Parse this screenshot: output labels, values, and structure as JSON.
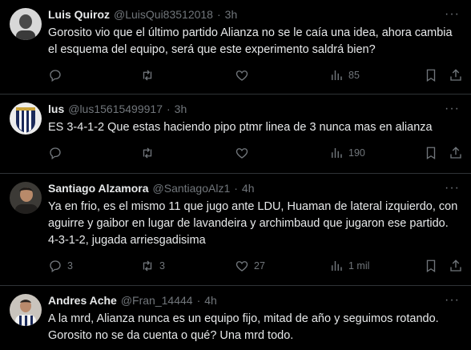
{
  "tweets": [
    {
      "name": "Luis Quiroz",
      "handle": "@LuisQui83512018",
      "dot": "·",
      "time": "3h",
      "text": "Gorosito vio que el último partido Alianza no se le caía una idea, ahora cambia el esquema del equipo,  será que este experimento saldrá bien?",
      "replies": "",
      "retweets": "",
      "likes": "",
      "views": "85"
    },
    {
      "name": "lus",
      "handle": "@lus15615499917",
      "dot": "·",
      "time": "3h",
      "text": "ES 3-4-1-2 Que estas haciendo pipo ptmr linea de 3 nunca mas en alianza",
      "replies": "",
      "retweets": "",
      "likes": "",
      "views": "190"
    },
    {
      "name": "Santiago Alzamora",
      "handle": "@SantiagoAlz1",
      "dot": "·",
      "time": "4h",
      "text": "Ya en frio, es el mismo 11 que jugo ante LDU, Huaman de lateral izquierdo, con aguirre y gaibor en lugar de lavandeira y archimbaud que jugaron ese partido. 4-3-1-2, jugada arriesgadisima",
      "replies": "3",
      "retweets": "3",
      "likes": "27",
      "views": "1 mil"
    },
    {
      "name": "Andres Ache",
      "handle": "@Fran_14444",
      "dot": "·",
      "time": "4h",
      "text": "A la mrd, Alianza nunca es un equipo fijo, mitad de año y seguimos rotando. Gorosito no se da cuenta o qué? Una mrd todo.",
      "replies": "",
      "retweets": "",
      "likes": "",
      "views": ""
    }
  ],
  "more_label": "···",
  "colors": {
    "background": "#000000",
    "text": "#e7e9ea",
    "muted": "#71767b",
    "divider": "#2f3336"
  },
  "icons": [
    "reply-icon",
    "retweet-icon",
    "like-icon",
    "views-icon",
    "bookmark-icon",
    "share-icon",
    "more-icon"
  ]
}
